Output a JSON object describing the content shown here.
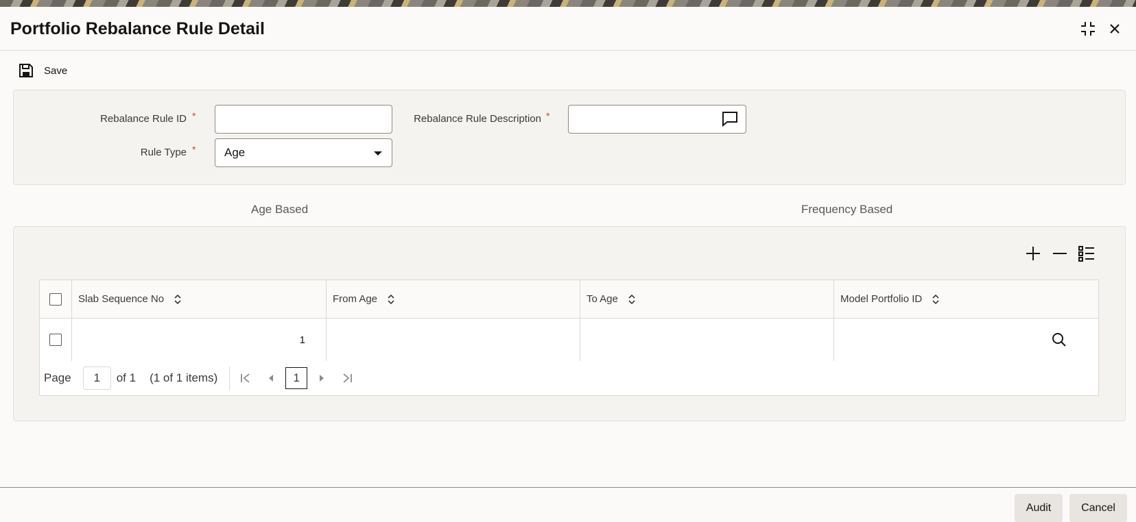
{
  "window": {
    "title": "Portfolio Rebalance Rule Detail"
  },
  "toolbar": {
    "save_label": "Save"
  },
  "form": {
    "rule_id_label": "Rebalance Rule ID",
    "rule_id_value": "",
    "rule_desc_label": "Rebalance Rule Description",
    "rule_desc_value": "",
    "rule_type_label": "Rule Type",
    "rule_type_value": "Age",
    "required_marker": "*"
  },
  "tabs": [
    {
      "label": "Age Based"
    },
    {
      "label": "Frequency Based"
    }
  ],
  "grid": {
    "columns": [
      "Slab Sequence No",
      "From Age",
      "To Age",
      "Model Portfolio ID"
    ],
    "rows": [
      {
        "slab_sequence_no": "1",
        "from_age": "",
        "to_age": "",
        "model_portfolio_id": ""
      }
    ]
  },
  "pager": {
    "page_label": "Page",
    "page_value": "1",
    "of_label": "of 1",
    "items_label": "(1 of 1 items)",
    "current_page": "1"
  },
  "footer": {
    "audit_label": "Audit",
    "cancel_label": "Cancel"
  },
  "colors": {
    "required": "#c74634",
    "text": "#161513",
    "panel": "#f5f3f0"
  }
}
